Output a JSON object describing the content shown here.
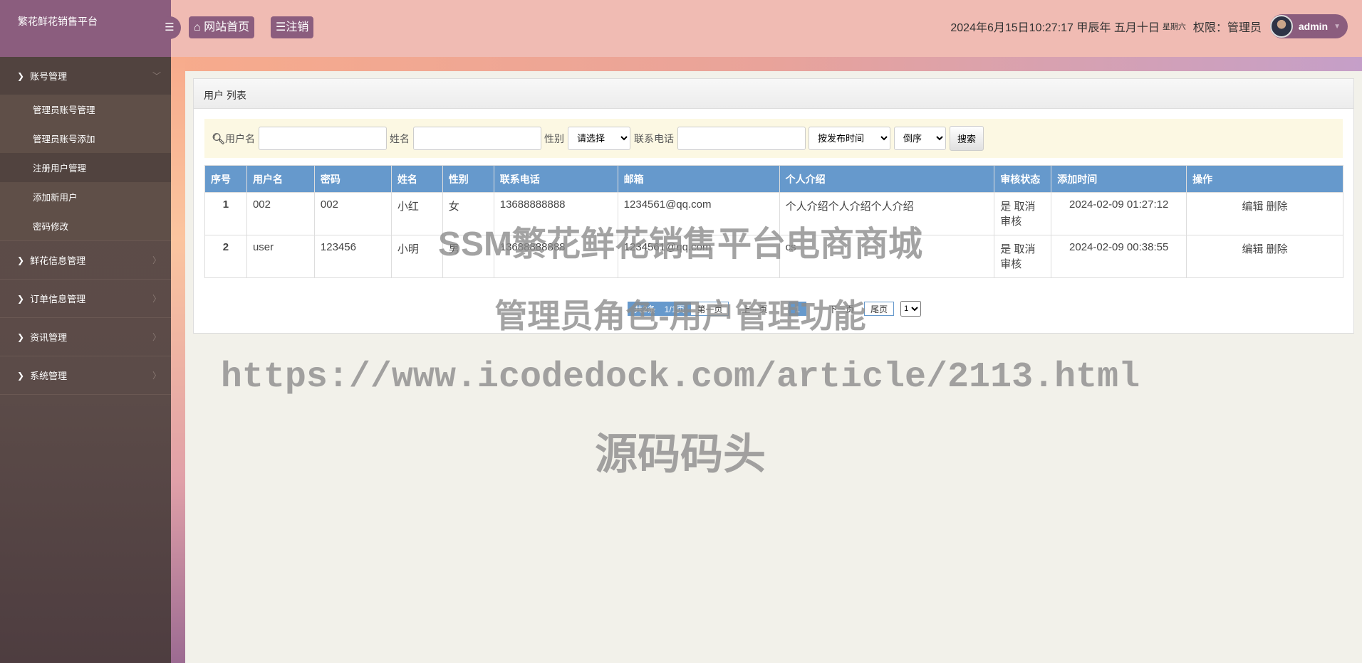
{
  "app": {
    "brand": "繁花鲜花销售平台"
  },
  "topbar": {
    "home": "网站首页",
    "logout": "注销",
    "datetime": "2024年6月15日10:27:17 甲辰年 五月十日",
    "weekday": "星期六",
    "role": "权限：管理员",
    "user": "admin"
  },
  "sidebar": [
    {
      "label": "账号管理",
      "open": true,
      "items": [
        "管理员账号管理",
        "管理员账号添加",
        "注册用户管理",
        "添加新用户",
        "密码修改"
      ]
    },
    {
      "label": "鲜花信息管理"
    },
    {
      "label": "订单信息管理"
    },
    {
      "label": "资讯管理"
    },
    {
      "label": "系统管理"
    }
  ],
  "panel": {
    "title": "用户 列表"
  },
  "search": {
    "username_label": "用户名",
    "name_label": "姓名",
    "gender_label": "性别",
    "gender_value": "请选择",
    "phone_label": "联系电话",
    "sort_value": "按发布时间",
    "order_value": "倒序",
    "button": "搜索"
  },
  "table": {
    "headers": [
      "序号",
      "用户名",
      "密码",
      "姓名",
      "性别",
      "联系电话",
      "邮箱",
      "个人介绍",
      "审核状态",
      "添加时间",
      "操作"
    ],
    "rows": [
      [
        "1",
        "002",
        "002",
        "小红",
        "女",
        "13688888888",
        "1234561@qq.com",
        "个人介绍个人介绍个人介绍",
        "是 取消审核",
        "2024-02-09 01:27:12"
      ],
      [
        "2",
        "user",
        "123456",
        "小明",
        "男",
        "13688888888",
        "1234561@qq.com",
        "cs",
        "是 取消审核",
        "2024-02-09 00:38:55"
      ]
    ],
    "edit": "编辑",
    "delete": "删除"
  },
  "pager": {
    "info": "共2条　1/1页",
    "first": "第一页",
    "prev": "上一页",
    "current": "1",
    "next": "下一页",
    "last": "尾页",
    "select": "1"
  },
  "watermark": {
    "line1": "SSM繁花鲜花销售平台电商商城",
    "line2": "管理员角色-用户管理功能",
    "url": "https://www.icodedock.com/article/2113.html",
    "brand": "源码码头"
  }
}
